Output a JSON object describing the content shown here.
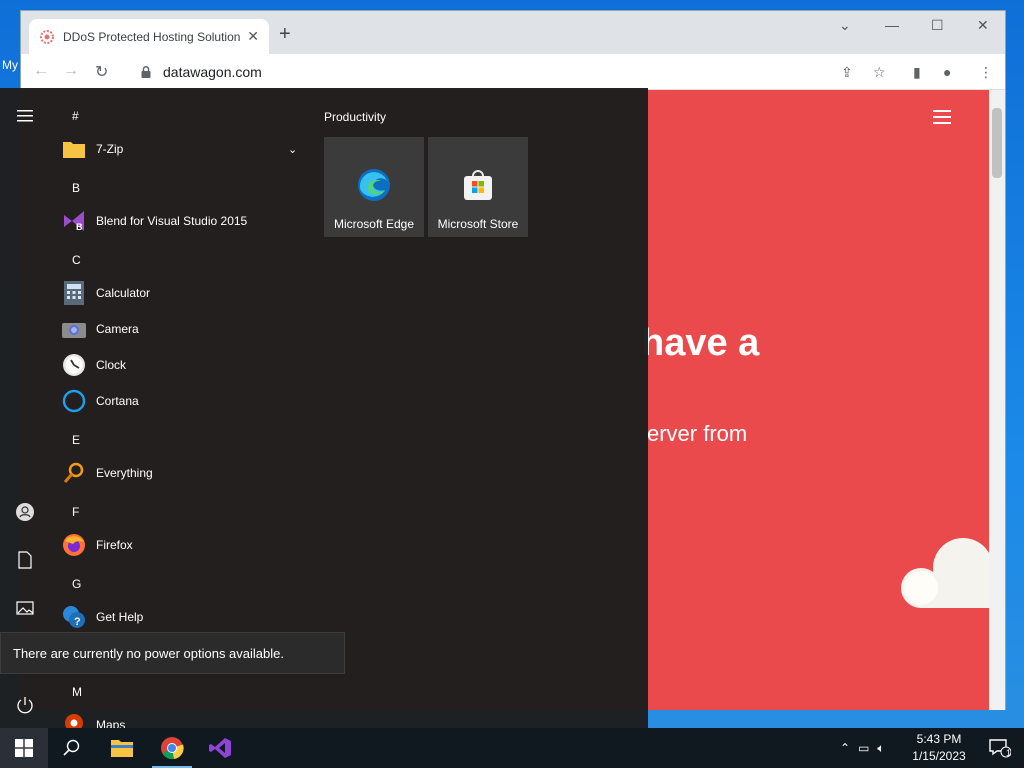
{
  "desktop": {
    "icon_label": "My"
  },
  "browser": {
    "tab_title": "DDoS Protected Hosting Solution",
    "url": "datawagon.com",
    "page": {
      "hero_heading": "have a",
      "hero_text": "erver from",
      "bg_color": "#ea4a4c"
    }
  },
  "start_menu": {
    "rail": [
      "hamburger-icon",
      "user-icon",
      "document-icon",
      "pictures-icon",
      "power-icon"
    ],
    "groups": [
      {
        "letter": "#",
        "apps": [
          {
            "name": "7-Zip",
            "icon": "folder-icon"
          }
        ]
      },
      {
        "letter": "B",
        "apps": [
          {
            "name": "Blend for Visual Studio 2015",
            "icon": "blend-icon"
          }
        ]
      },
      {
        "letter": "C",
        "apps": [
          {
            "name": "Calculator",
            "icon": "calculator-icon"
          },
          {
            "name": "Camera",
            "icon": "camera-icon"
          },
          {
            "name": "Clock",
            "icon": "clock-icon"
          },
          {
            "name": "Cortana",
            "icon": "cortana-icon"
          }
        ]
      },
      {
        "letter": "E",
        "apps": [
          {
            "name": "Everything",
            "icon": "search-icon"
          }
        ]
      },
      {
        "letter": "F",
        "apps": [
          {
            "name": "Firefox",
            "icon": "firefox-icon"
          }
        ]
      },
      {
        "letter": "G",
        "apps": [
          {
            "name": "Get Help",
            "icon": "help-icon"
          }
        ]
      },
      {
        "letter": "M",
        "apps": [
          {
            "name": "Maps",
            "icon": "maps-icon"
          }
        ]
      }
    ],
    "tiles_group_title": "Productivity",
    "tiles": [
      {
        "label": "Microsoft Edge",
        "icon": "edge-icon"
      },
      {
        "label": "Microsoft Store",
        "icon": "store-icon"
      }
    ],
    "tooltip": "There are currently no power options available."
  },
  "taskbar": {
    "time": "5:43 PM",
    "date": "1/15/2023",
    "notification_count": "1"
  }
}
